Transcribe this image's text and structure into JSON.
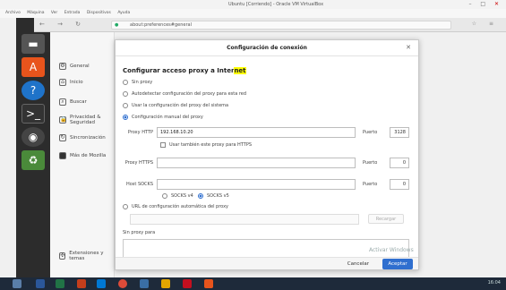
{
  "host": {
    "title": "Ubuntu [Corriendo] - Oracle VM VirtualBox",
    "menu": [
      "Archivo",
      "Máquina",
      "Ver",
      "Entrada",
      "Dispositivos",
      "Ayuda"
    ]
  },
  "browser": {
    "url": "about:preferences#general"
  },
  "sidebar": {
    "items": [
      {
        "label": "General",
        "icon": "gear-icon"
      },
      {
        "label": "Inicio",
        "icon": "home-icon"
      },
      {
        "label": "Buscar",
        "icon": "search-icon"
      },
      {
        "label": "Privacidad & Seguridad",
        "icon": "lock-icon"
      },
      {
        "label": "Sincronización",
        "icon": "sync-icon"
      },
      {
        "label": "Más de Mozilla",
        "icon": "mozilla-icon"
      },
      {
        "label": "Extensiones y temas",
        "icon": "puzzle-icon"
      }
    ]
  },
  "dialog": {
    "title": "Configuración de conexión",
    "heading_prefix": "Configurar acceso proxy a Inter",
    "heading_highlight": "net",
    "options": [
      {
        "label": "Sin proxy",
        "checked": false
      },
      {
        "label": "Autodetectar configuración del proxy para esta red",
        "checked": false
      },
      {
        "label": "Usar la configuración del proxy del sistema",
        "checked": false
      },
      {
        "label": "Configuración manual del proxy",
        "checked": true
      }
    ],
    "http_proxy": {
      "label": "Proxy HTTP",
      "value": "192.168.10.20",
      "port_label": "Puerto",
      "port": "3128"
    },
    "use_for_https": "Usar también este proxy para HTTPS",
    "https_proxy": {
      "label": "Proxy HTTPS",
      "value": "",
      "port_label": "Puerto",
      "port": "0"
    },
    "socks": {
      "label": "Host SOCKS",
      "value": "",
      "port_label": "Puerto",
      "port": "0"
    },
    "socks_v4": "SOCKS v4",
    "socks_v5": "SOCKS v5",
    "auto_url": "URL de configuración automática del proxy",
    "reload": "Recargar",
    "no_proxy": "Sin proxy para",
    "cancel": "Cancelar",
    "accept": "Aceptar"
  },
  "watermark": "Activar Windows",
  "tray": "16:04"
}
